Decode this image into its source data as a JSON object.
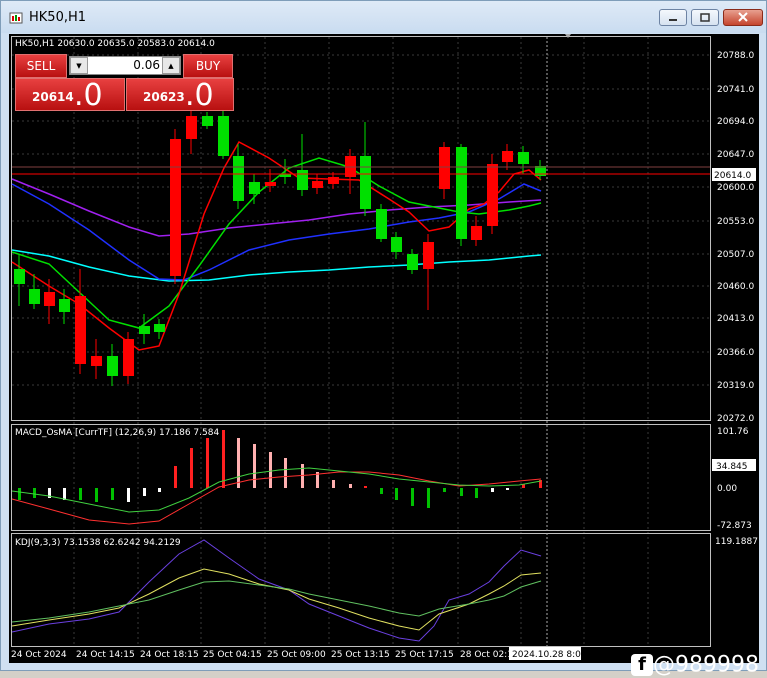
{
  "window": {
    "title": "HK50,H1"
  },
  "main_chart": {
    "info": "HK50,H1  20630.0  20635.0  20583.0  20614.0",
    "price_ticks": [
      "20788.0",
      "20741.0",
      "20694.0",
      "20647.0",
      "20600.0",
      "20553.0",
      "20507.0",
      "20460.0",
      "20413.0",
      "20366.0",
      "20319.0",
      "20272.0"
    ],
    "current_price": "20614.0"
  },
  "trade_panel": {
    "sell_label": "SELL",
    "buy_label": "BUY",
    "lot": "0.06",
    "sell_price_small": "20614",
    "sell_price_big": ".0",
    "buy_price_small": "20623",
    "buy_price_big": ".0"
  },
  "macd": {
    "info": "MACD_OsMA [CurrTF] (12,26,9) 17.186 7.584",
    "ticks": [
      "101.76",
      "34.845",
      "0.00",
      "-72.873"
    ]
  },
  "kdj": {
    "info": "KDJ(9,3,3) 73.1538 62.6242 94.2129",
    "ticks": [
      "119.1887"
    ]
  },
  "time_axis": {
    "labels": [
      "24 Oct 2024",
      "24 Oct 14:15",
      "24 Oct 18:15",
      "25 Oct 04:15",
      "25 Oct 09:00",
      "25 Oct 13:15",
      "25 Oct 17:15",
      "28 Oct 02:1"
    ],
    "cursor_label": "2024.10.28 8:00"
  },
  "colors": {
    "up": "#00e000",
    "down": "#ff0000",
    "background": "#000000"
  },
  "watermark": "@989998"
}
